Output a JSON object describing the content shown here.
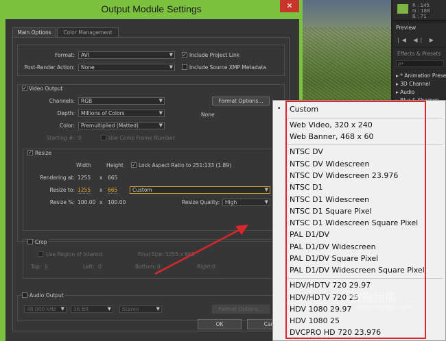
{
  "host": {
    "info_values": [
      "R : 145",
      "G : 188",
      "B : 71"
    ],
    "preview_tab": "Preview",
    "preview_controls": "|◀ ◀| ▶",
    "effects_tab": "Effects & Presets",
    "effects_search": "ρ•",
    "effects_items": [
      "▸ * Animation Prese",
      "▸ 3D Channel",
      "▸ Audio",
      "▸ Blur & Sharpen"
    ]
  },
  "dialog": {
    "title": "Output Module Settings",
    "close_glyph": "✕",
    "tabs": [
      "Main Options",
      "Color Management"
    ],
    "format_label": "Format:",
    "format_value": "AVI",
    "post_render_label": "Post-Render Action:",
    "post_render_value": "None",
    "include_project_link": "Include Project Link",
    "include_xmp": "Include Source XMP Metadata",
    "video_output": {
      "title": "Video Output",
      "channels_label": "Channels:",
      "channels_value": "RGB",
      "depth_label": "Depth:",
      "depth_value": "Millions of Colors",
      "color_label": "Color:",
      "color_value": "Premultiplied (Matted)",
      "format_options_button": "Format Options...",
      "format_options_info": "None",
      "starting_label": "Starting #:",
      "starting_value": "0",
      "use_comp_frame": "Use Comp Frame Number"
    },
    "resize": {
      "title": "Resize",
      "width_header": "Width",
      "height_header": "Height",
      "lock_aspect": "Lock Aspect Ratio to 251:133 (1.89)",
      "rendering_label": "Rendering at:",
      "rendering_w": "1255",
      "x1": "x",
      "rendering_h": "665",
      "resize_to_label": "Resize to:",
      "resize_w": "1255",
      "x2": "x",
      "resize_h": "665",
      "preset_value": "Custom",
      "resize_pct_label": "Resize %:",
      "resize_pct_w": "100.00",
      "x3": "x",
      "resize_pct_h": "100.00",
      "quality_label": "Resize Quality:",
      "quality_value": "High"
    },
    "crop": {
      "title": "Crop",
      "use_roi": "Use Region of Interest",
      "final_size": "Final Size: 1255 x 665",
      "top_label": "Top:",
      "top_value": "0",
      "left_label": "Left:",
      "left_value": "0",
      "bottom_label": "Bottom:",
      "bottom_value": "0",
      "right_label": "Right:",
      "right_value": "0"
    },
    "audio_output": {
      "title": "Audio Output",
      "rate_value": "48.000 kHz",
      "bits_value": "16 Bit",
      "channels_value": "Stereo",
      "format_options_button": "Format Options..."
    },
    "ok_button": "OK",
    "cancel_button": "Can"
  },
  "menu": {
    "check_glyph": "•",
    "items": [
      "Custom",
      "Web Video, 320 x 240",
      "Web Banner, 468 x 60",
      "NTSC DV",
      "NTSC DV Widescreen",
      "NTSC DV Widescreen 23.976",
      "NTSC D1",
      "NTSC D1 Widescreen",
      "NTSC D1 Square Pixel",
      "NTSC D1 Widescreen Square Pixel",
      "PAL D1/DV",
      "PAL D1/DV Widescreen",
      "PAL D1/DV Square Pixel",
      "PAL D1/DV Widescreen Square Pixel",
      "HDV/HDTV 720 29.97",
      "HDV/HDTV 720 25",
      "HDV 1080 29.97",
      "HDV 1080 25",
      "DVCPRO HD 720 23.976"
    ],
    "selected": "Custom"
  },
  "watermark": {
    "text": "搜狗指南",
    "url": "zhinan.sogou.com"
  },
  "colors": {
    "window_frame": "#7cc23f",
    "annotation_red": "#d9262c",
    "accent_orange": "#e2a43a"
  }
}
